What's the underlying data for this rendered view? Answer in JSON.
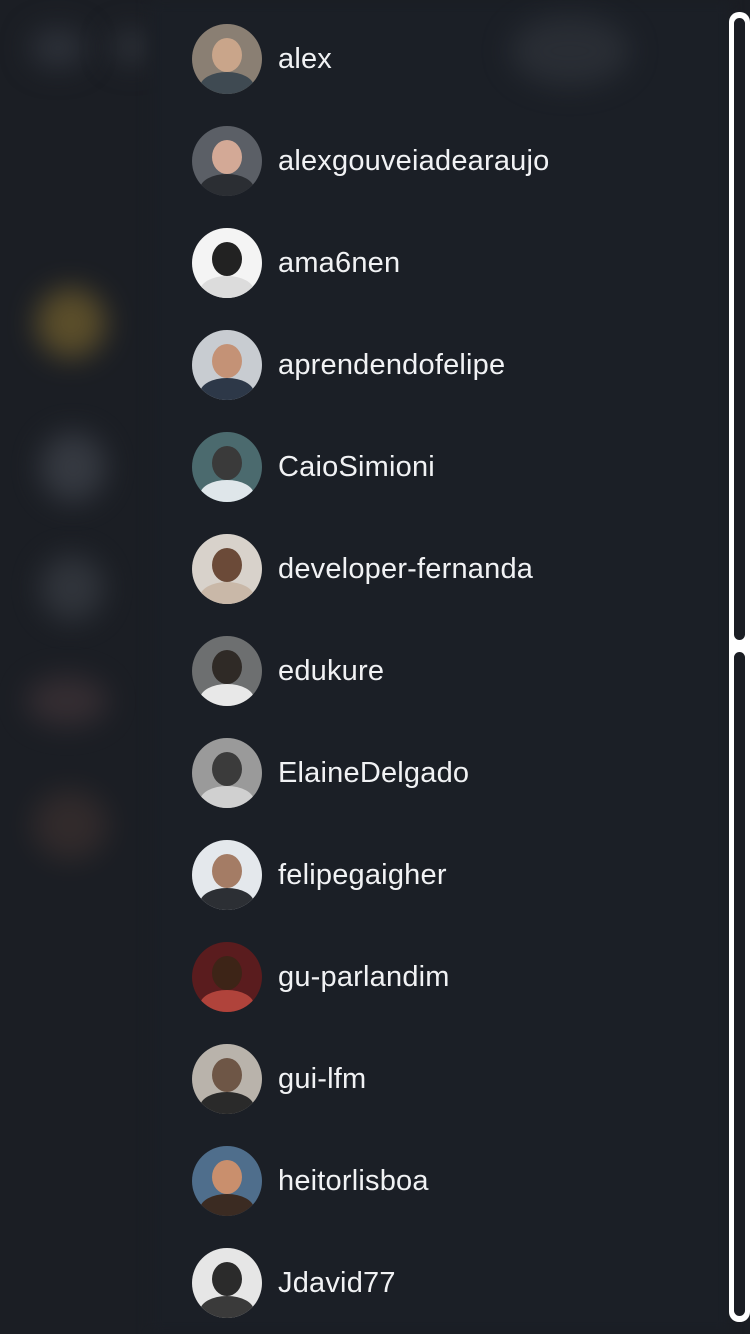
{
  "users": [
    {
      "username": "alex",
      "avatar": {
        "bg": "#8a7f73",
        "head": "#c9a58a",
        "body": "#3f4a52"
      }
    },
    {
      "username": "alexgouveiadearaujo",
      "avatar": {
        "bg": "#5b5f66",
        "head": "#d3a996",
        "body": "#2b2e33"
      }
    },
    {
      "username": "ama6nen",
      "avatar": {
        "bg": "#f4f4f4",
        "head": "#222222",
        "body": "#dcdcdc"
      }
    },
    {
      "username": "aprendendofelipe",
      "avatar": {
        "bg": "#c8ccd1",
        "head": "#c49276",
        "body": "#2d3848"
      }
    },
    {
      "username": "CaioSimioni",
      "avatar": {
        "bg": "#4b6a6e",
        "head": "#3a3a3a",
        "body": "#dfe6ea"
      }
    },
    {
      "username": "developer-fernanda",
      "avatar": {
        "bg": "#d8d2cb",
        "head": "#6b4a38",
        "body": "#c9b8a8"
      }
    },
    {
      "username": "edukure",
      "avatar": {
        "bg": "#6d6f70",
        "head": "#2f2a26",
        "body": "#e8e8e8"
      }
    },
    {
      "username": "ElaineDelgado",
      "avatar": {
        "bg": "#9a9a9a",
        "head": "#3b3b3b",
        "body": "#d0d0d0"
      }
    },
    {
      "username": "felipegaigher",
      "avatar": {
        "bg": "#e4e8ec",
        "head": "#a47c65",
        "body": "#2c2f34"
      }
    },
    {
      "username": "gu-parlandim",
      "avatar": {
        "bg": "#5a1c1e",
        "head": "#3d2417",
        "body": "#b0433b"
      }
    },
    {
      "username": "gui-lfm",
      "avatar": {
        "bg": "#b9b3ab",
        "head": "#6e5646",
        "body": "#2a2a2a"
      }
    },
    {
      "username": "heitorlisboa",
      "avatar": {
        "bg": "#4f6e8c",
        "head": "#c98f6d",
        "body": "#3b2b22"
      }
    },
    {
      "username": "Jdavid77",
      "avatar": {
        "bg": "#e6e6e6",
        "head": "#2b2b2b",
        "body": "#3a3a3a"
      }
    }
  ]
}
